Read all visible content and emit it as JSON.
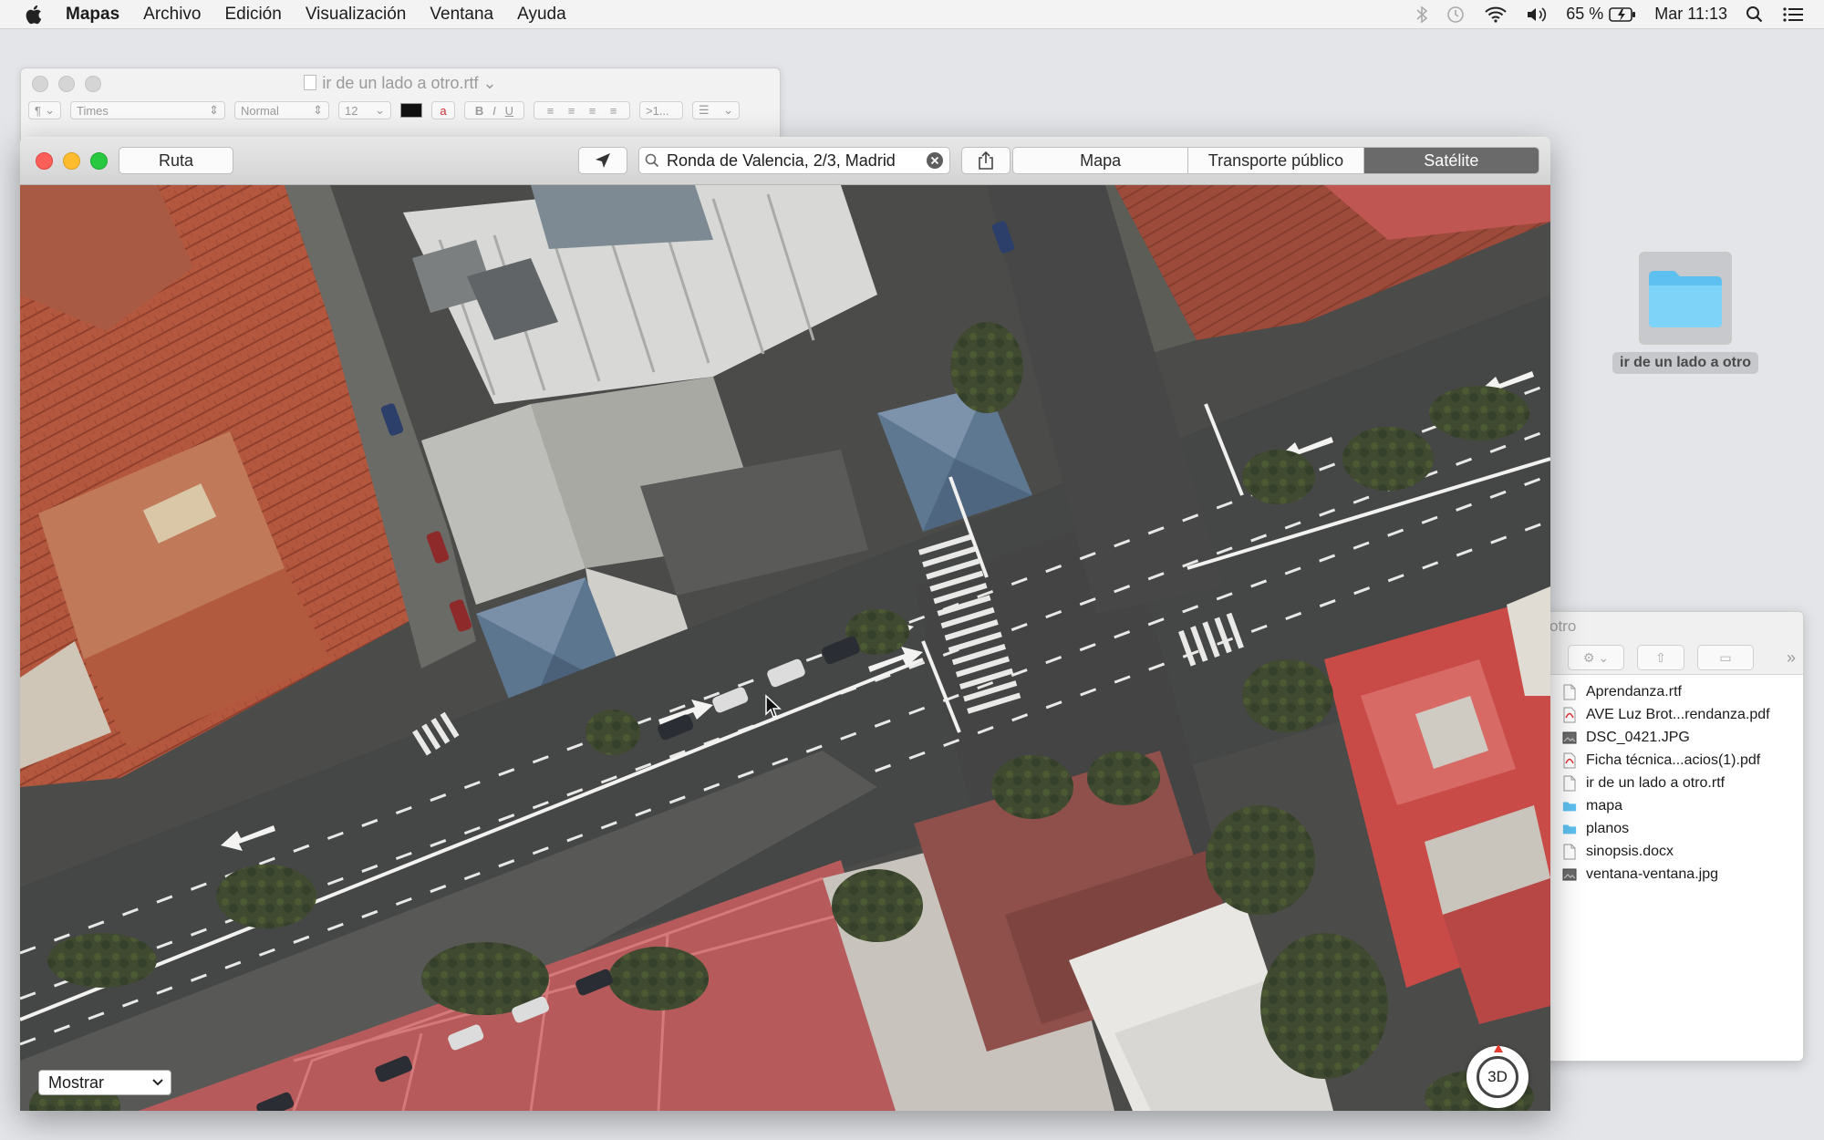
{
  "menubar": {
    "app_name": "Mapas",
    "items": [
      "Archivo",
      "Edición",
      "Visualización",
      "Ventana",
      "Ayuda"
    ],
    "battery": "65 %",
    "clock": "Mar 11:13"
  },
  "desktop": {
    "folder_label": "ir de un lado a otro"
  },
  "textedit": {
    "title": "ir de un lado a otro.rtf",
    "font_family": "Times",
    "font_style": "Normal",
    "font_size": "12",
    "spacing": ">1..."
  },
  "finder": {
    "title_fragment": "otro",
    "more_glyph": "»",
    "files": [
      {
        "name": "Aprendanza.rtf",
        "kind": "doc"
      },
      {
        "name": "AVE Luz Brot...rendanza.pdf",
        "kind": "pdf"
      },
      {
        "name": "DSC_0421.JPG",
        "kind": "image"
      },
      {
        "name": "Ficha técnica...acios(1).pdf",
        "kind": "pdf"
      },
      {
        "name": "ir de un lado a otro.rtf",
        "kind": "doc"
      },
      {
        "name": "mapa",
        "kind": "folder"
      },
      {
        "name": "planos",
        "kind": "folder"
      },
      {
        "name": "sinopsis.docx",
        "kind": "doc"
      },
      {
        "name": "ventana-ventana.jpg",
        "kind": "image"
      }
    ]
  },
  "maps": {
    "route_label": "Ruta",
    "search_value": "Ronda de Valencia, 2/3, Madrid",
    "tabs": [
      {
        "label": "Mapa",
        "active": false
      },
      {
        "label": "Transporte público",
        "active": false
      },
      {
        "label": "Satélite",
        "active": true
      }
    ],
    "show_label": "Mostrar",
    "three_d_label": "3D",
    "zoom_out": "−",
    "zoom_in": "+"
  }
}
